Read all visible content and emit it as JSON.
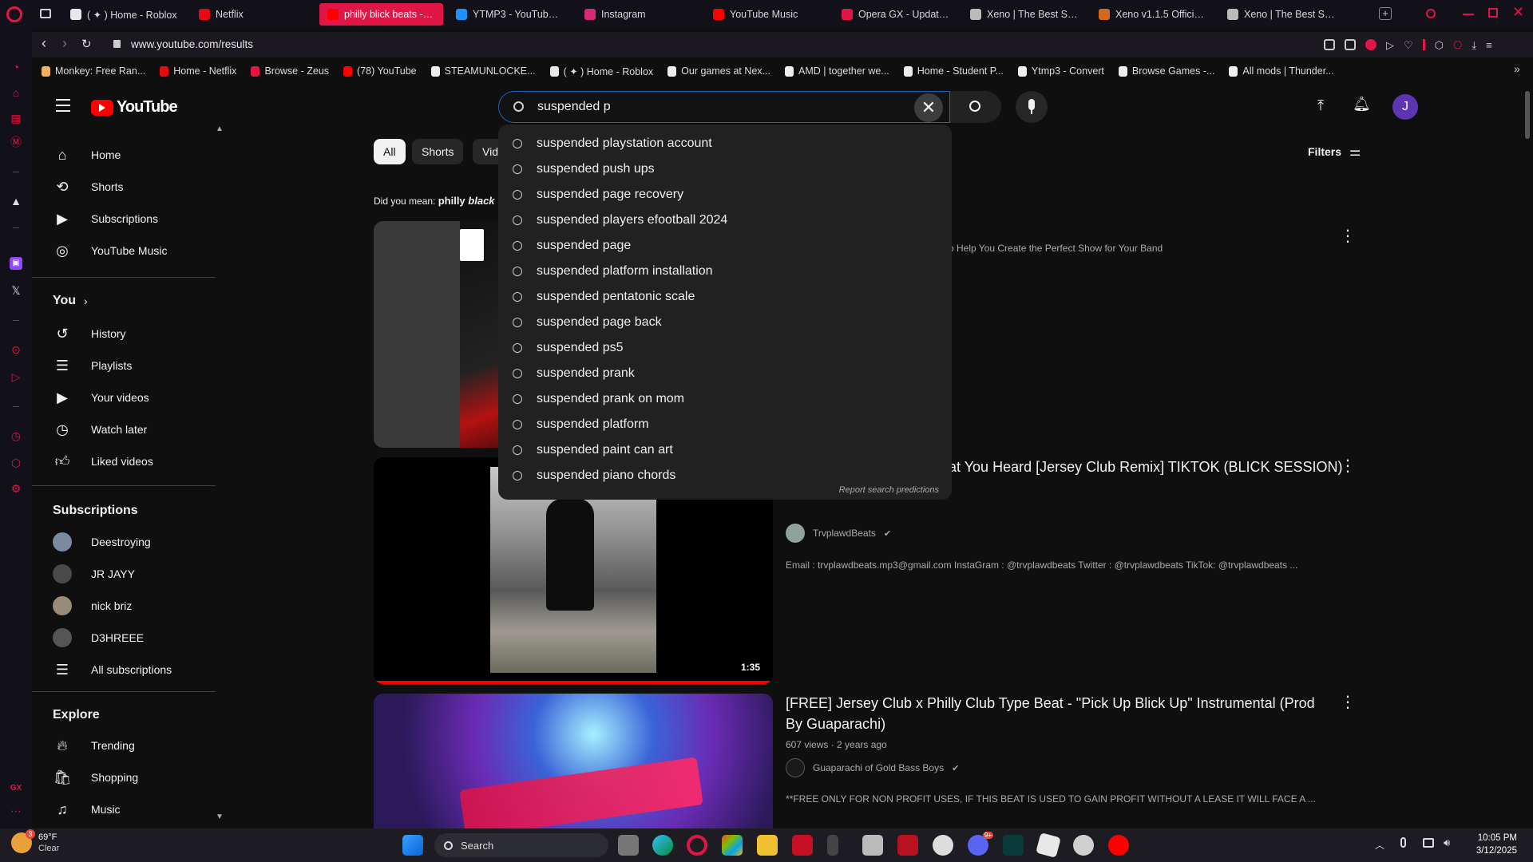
{
  "browser": {
    "tabs": [
      {
        "label": "( ✦ ) Home - Roblox",
        "color": "#e8e8e8"
      },
      {
        "label": "Netflix",
        "color": "#e50914"
      },
      {
        "label": "philly blick beats - YouTube",
        "color": "#ff0000",
        "active": true
      },
      {
        "label": "YTMP3 - YouTube to",
        "color": "#1e90ff"
      },
      {
        "label": "Instagram",
        "color": "#d62976"
      },
      {
        "label": "YouTube Music",
        "color": "#ff0000"
      },
      {
        "label": "Opera GX - Update c",
        "color": "#e01646"
      },
      {
        "label": "Xeno | The Best Scri",
        "color": "#bbbbbb"
      },
      {
        "label": "Xeno v1.1.5 Official D",
        "color": "#d2691e"
      },
      {
        "label": "Xeno | The Best Scri",
        "color": "#bbbbbb"
      }
    ],
    "url": "www.youtube.com/results",
    "bookmarks": [
      "Monkey: Free Ran...",
      "Home - Netflix",
      "Browse - Zeus",
      "(78) YouTube",
      "STEAMUNLOCKE...",
      "( ✦ ) Home - Roblox",
      "Our games at Nex...",
      "AMD | together we...",
      "Home - Student P...",
      "Ytmp3 - Convert",
      "Browse Games -...",
      "All mods | Thunder..."
    ]
  },
  "youtube": {
    "logo_text": "YouTube",
    "search": {
      "value": "suspended p",
      "suggestions": [
        "suspended playstation account",
        "suspended push ups",
        "suspended page recovery",
        "suspended players efootball 2024",
        "suspended page",
        "suspended platform installation",
        "suspended pentatonic scale",
        "suspended page back",
        "suspended ps5",
        "suspended prank",
        "suspended prank on mom",
        "suspended platform",
        "suspended paint can art",
        "suspended piano chords"
      ],
      "report_text": "Report search predictions"
    },
    "user_initial": "J",
    "sidebar": {
      "main": [
        "Home",
        "Shorts",
        "Subscriptions",
        "YouTube Music"
      ],
      "you_label": "You",
      "you_items": [
        "History",
        "Playlists",
        "Your videos",
        "Watch later",
        "Liked videos"
      ],
      "subs_title": "Subscriptions",
      "subs": [
        "Deestroying",
        "JR JAYY",
        "nick briz",
        "D3HREEE"
      ],
      "all_subs": "All subscriptions",
      "explore_title": "Explore",
      "explore": [
        "Trending",
        "Shopping",
        "Music"
      ]
    },
    "chips": [
      "All",
      "Shorts",
      "Vid"
    ],
    "filters_label": "Filters",
    "did_you_mean_prefix": "Did you mean:",
    "did_you_mean_term": "philly",
    "did_you_mean_italic": "black",
    "results": [
      {
        "title_partial": "o Help You Create the Perfect Show for Your Band"
      },
      {
        "title_partial": "at You Heard [Jersey Club Remix] TIKTOK (BLICK SESSION)",
        "channel": "TrvplawdBeats",
        "description": "Email : trvplawdbeats.mp3@gmail.com InstaGram : @trvplawdbeats Twitter : @trvplawdbeats TikTok: @trvplawdbeats ...",
        "duration": "1:35",
        "progress": 1.0
      },
      {
        "title": "[FREE] Jersey Club x Philly Club Type Beat - \"Pick Up Blick Up\" Instrumental (Prod By Guaparachi)",
        "meta": "607 views · 2 years ago",
        "channel": "Guaparachi of Gold Bass Boys",
        "description": "**FREE ONLY FOR NON PROFIT USES, IF THIS BEAT IS USED TO GAIN PROFIT WITHOUT A LEASE IT WILL FACE A ..."
      }
    ]
  },
  "taskbar": {
    "weather_temp": "69°F",
    "weather_desc": "Clear",
    "weather_badge": "3",
    "search_label": "Search",
    "time": "10:05 PM",
    "date": "3/12/2025",
    "discord_badge": "9+"
  },
  "colors": {
    "opera_accent": "#e01646",
    "yt_red": "#ff0000",
    "yt_bg": "#0f0f0f",
    "dropdown_bg": "#212121"
  }
}
